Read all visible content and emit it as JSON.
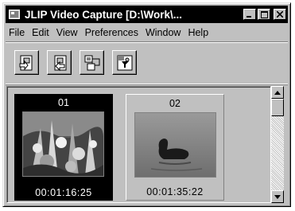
{
  "window": {
    "title": "JLIP Video Capture [D:\\Work\\..."
  },
  "menu": {
    "items": [
      "File",
      "Edit",
      "View",
      "Preferences",
      "Window",
      "Help"
    ]
  },
  "toolbar": {
    "buttons": [
      "capture-icon",
      "capture-sequence-icon",
      "multi-frame-icon",
      "filter-icon"
    ]
  },
  "thumbnails": [
    {
      "number": "01",
      "timecode": "00:01:16:25",
      "selected": true
    },
    {
      "number": "02",
      "timecode": "00:01:35:22",
      "selected": false
    }
  ],
  "colors": {
    "titlebar": "#000000",
    "face": "#c0c0c0",
    "selection": "#000000"
  }
}
